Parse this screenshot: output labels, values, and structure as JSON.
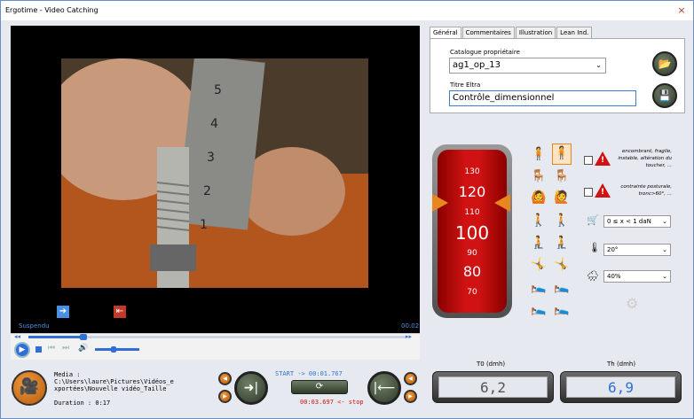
{
  "window": {
    "title": "Ergotime - Video Catching",
    "close_label": "×"
  },
  "video": {
    "status": "Suspendu",
    "time": "00:02",
    "play_icon": "play-icon",
    "ruler_marks": [
      "5",
      "4",
      "3",
      "2",
      "1"
    ]
  },
  "tabs": [
    {
      "label": "Général",
      "active": true
    },
    {
      "label": "Commentaires",
      "active": false
    },
    {
      "label": "Illustration",
      "active": false
    },
    {
      "label": "Lean Ind.",
      "active": false
    }
  ],
  "general": {
    "catalogue_label": "Catalogue propriétaire",
    "catalogue_value": "ag1_op_13",
    "titre_label": "Titre Eltra",
    "titre_value": "Contrôle_dimensionnel"
  },
  "gauge": {
    "values": [
      "130",
      "120",
      "110",
      "100",
      "90",
      "80",
      "70"
    ]
  },
  "warnings": [
    {
      "text": "encombrant, fragile, instable, altération du toucher, ..."
    },
    {
      "text": "contrainte posturale, tronc>60°, ..."
    }
  ],
  "selects": {
    "weight": "0 ≤ x < 1 daN",
    "temperature": "20°",
    "humidity": "40%"
  },
  "media": {
    "label": "Media :",
    "path_line1": "C:\\Users\\laure\\Pictures\\Vidéos_e",
    "path_line2": "xportées\\Nouvelle vidéo_Taille",
    "duration": "Duration : 0:17"
  },
  "timing": {
    "start": "START -> 00:01.767",
    "stop": "00:03.697 <- stop"
  },
  "t0": {
    "label": "T0 (dmh)",
    "value": "6,2"
  },
  "th": {
    "label": "Th (dmh)",
    "value": "6,9"
  },
  "colors": {
    "accent": "#2f6fd6",
    "stop": "#d01212",
    "gauge": "#d01212",
    "orange": "#e8871e"
  }
}
